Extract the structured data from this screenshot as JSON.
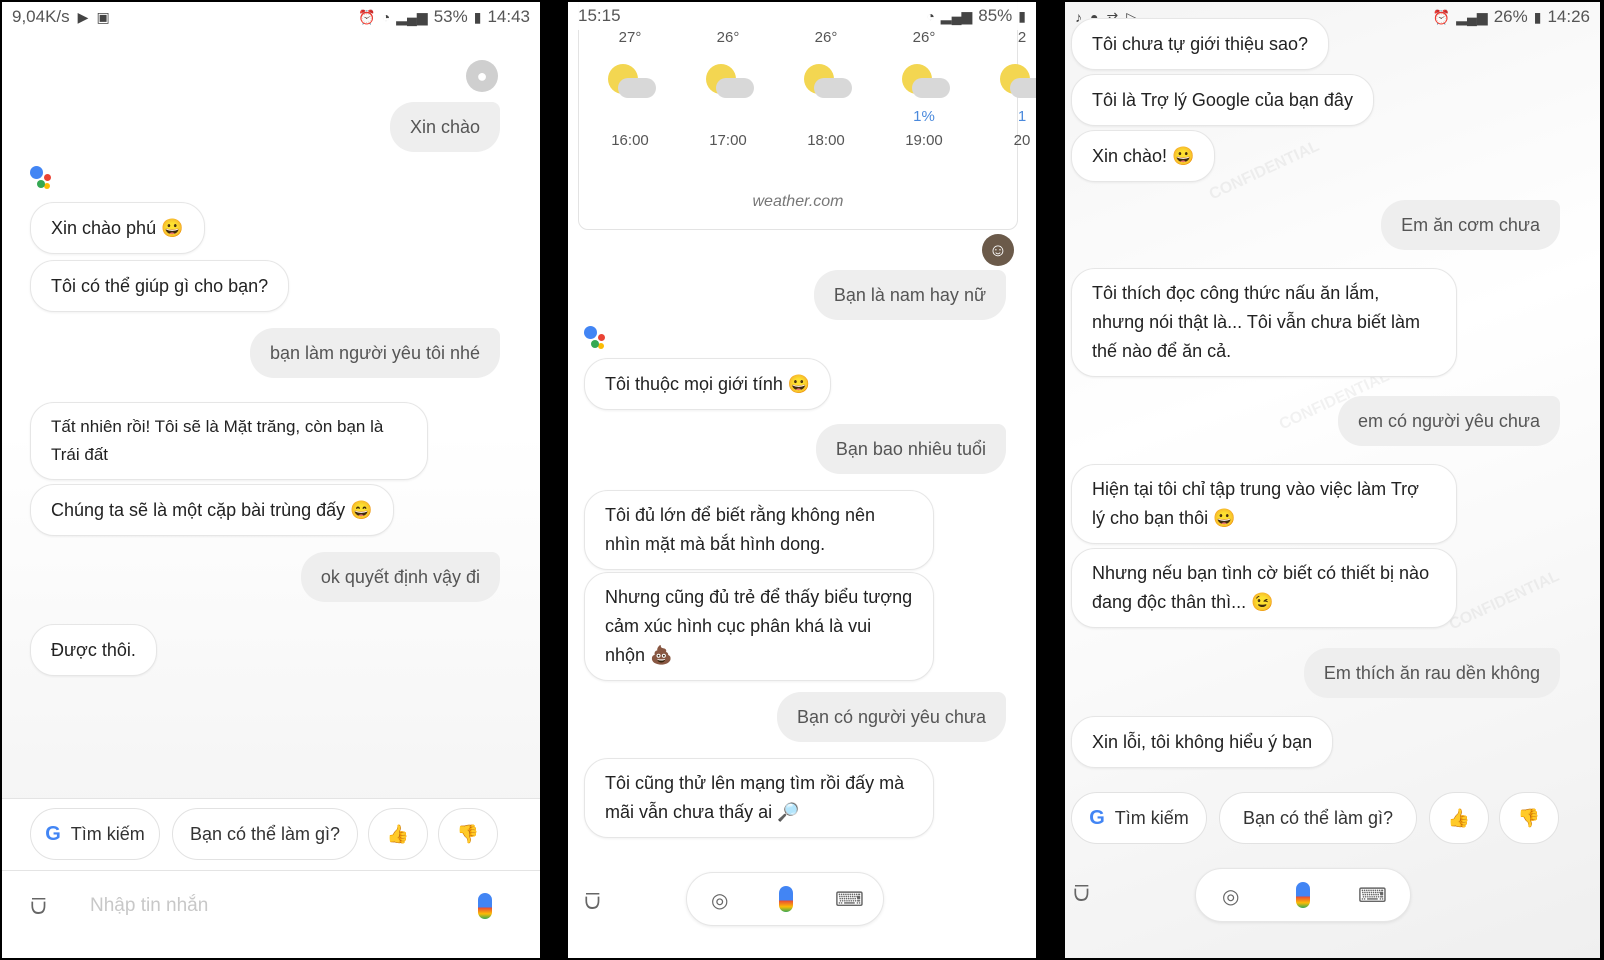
{
  "panel1": {
    "status": {
      "speed": "9,04K/s",
      "battery": "53%",
      "time": "14:43"
    },
    "messages": [
      {
        "role": "user",
        "text": "Xin chào"
      },
      {
        "role": "bot",
        "text": "Xin chào phú 😀"
      },
      {
        "role": "bot",
        "text": "Tôi có thể giúp gì cho bạn?"
      },
      {
        "role": "user",
        "text": "bạn làm người yêu tôi nhé"
      },
      {
        "role": "bot",
        "text": "Tất nhiên rồi! Tôi sẽ là Mặt trăng, còn bạn là Trái đất"
      },
      {
        "role": "bot",
        "text": "Chúng ta sẽ là một cặp bài trùng đấy 😄"
      },
      {
        "role": "user",
        "text": "ok quyết định vậy đi"
      },
      {
        "role": "bot",
        "text": "Được thôi."
      }
    ],
    "chips": {
      "search": "Tìm kiếm",
      "what_can": "Bạn có thể làm gì?",
      "thumbs_up": "👍",
      "thumbs_down": "👎"
    },
    "input_placeholder": "Nhập tin nhắn"
  },
  "panel2": {
    "status": {
      "time": "15:15",
      "battery": "85%"
    },
    "weather": {
      "hours": [
        {
          "temp": "27°",
          "time": "16:00",
          "precip": ""
        },
        {
          "temp": "26°",
          "time": "17:00",
          "precip": ""
        },
        {
          "temp": "26°",
          "time": "18:00",
          "precip": ""
        },
        {
          "temp": "26°",
          "time": "19:00",
          "precip": "1%"
        },
        {
          "temp": "2",
          "time": "20",
          "precip": "1"
        }
      ],
      "source": "weather.com"
    },
    "messages": [
      {
        "role": "user",
        "text": "Bạn là nam hay nữ"
      },
      {
        "role": "bot",
        "text": "Tôi thuộc mọi giới tính 😀"
      },
      {
        "role": "user",
        "text": "Bạn bao nhiêu tuổi"
      },
      {
        "role": "bot",
        "text": "Tôi đủ lớn để biết rằng không nên nhìn mặt mà bắt hình dong."
      },
      {
        "role": "bot",
        "text": "Nhưng cũng đủ trẻ để thấy biểu tượng cảm xúc hình cục phân khá là vui nhộn 💩"
      },
      {
        "role": "user",
        "text": "Bạn có người yêu chưa"
      },
      {
        "role": "bot",
        "text": "Tôi cũng thử lên mạng tìm rồi đấy mà mãi vẫn chưa thấy ai 🔎"
      }
    ]
  },
  "panel3": {
    "status": {
      "battery": "26%",
      "time": "14:26"
    },
    "messages": [
      {
        "role": "bot",
        "text": "Tôi chưa tự giới thiệu sao?"
      },
      {
        "role": "bot",
        "text": "Tôi là Trợ lý Google của bạn đây"
      },
      {
        "role": "bot",
        "text": "Xin chào! 😀"
      },
      {
        "role": "user",
        "text": "Em ăn cơm chưa"
      },
      {
        "role": "bot",
        "text": "Tôi thích đọc công thức nấu ăn lắm, nhưng nói thật là... Tôi vẫn chưa biết làm thế nào để ăn cả."
      },
      {
        "role": "user",
        "text": "em có người yêu chưa"
      },
      {
        "role": "bot",
        "text": "Hiện tại tôi chỉ tập trung vào việc làm Trợ lý  cho bạn thôi 😀"
      },
      {
        "role": "bot",
        "text": "Nhưng nếu bạn tình cờ biết có thiết bị nào đang độc thân thì... 😉"
      },
      {
        "role": "user",
        "text": "Em thích ăn rau dền không"
      },
      {
        "role": "bot",
        "text": "Xin lỗi, tôi không hiểu ý bạn"
      }
    ],
    "chips": {
      "search": "Tìm kiếm",
      "what_can": "Bạn có thể làm gì?",
      "thumbs_up": "👍",
      "thumbs_down": "👎"
    },
    "watermark": "CONFIDENTIAL"
  }
}
